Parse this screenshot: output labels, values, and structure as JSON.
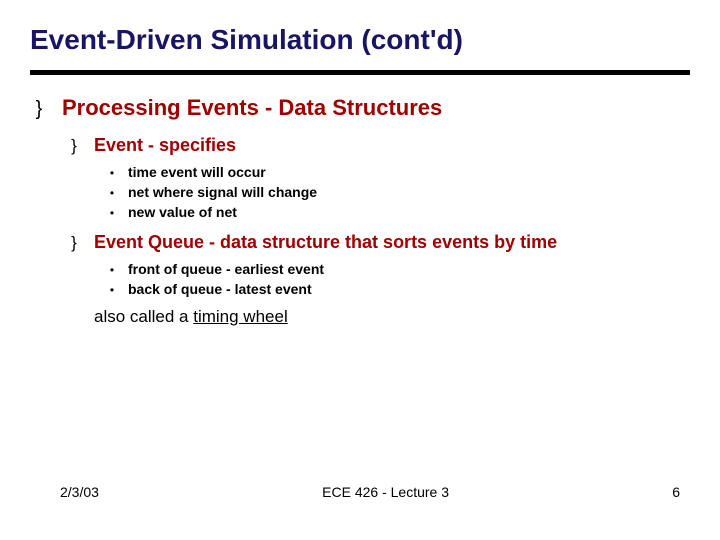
{
  "title": "Event-Driven Simulation (cont'd)",
  "main": {
    "heading": "Processing Events - Data Structures",
    "event": {
      "label": "Event - specifies",
      "items": [
        {
          "strong": "time",
          "rest": " event will occur"
        },
        {
          "strong": "net",
          "rest": " where signal will change"
        },
        {
          "strong": "new value",
          "rest": " of net"
        }
      ]
    },
    "queue": {
      "label": "Event Queue - data structure that sorts events by time",
      "items": [
        {
          "strong": "front of queue - earliest event",
          "rest": ""
        },
        {
          "strong": "back of queue - latest event",
          "rest": ""
        }
      ],
      "note_prefix": "also called a ",
      "note_underlined": "timing wheel"
    }
  },
  "footer": {
    "date": "2/3/03",
    "center": "ECE 426 - Lecture 3",
    "page": "6"
  },
  "bullets": {
    "curly": "}",
    "dot": "•"
  }
}
